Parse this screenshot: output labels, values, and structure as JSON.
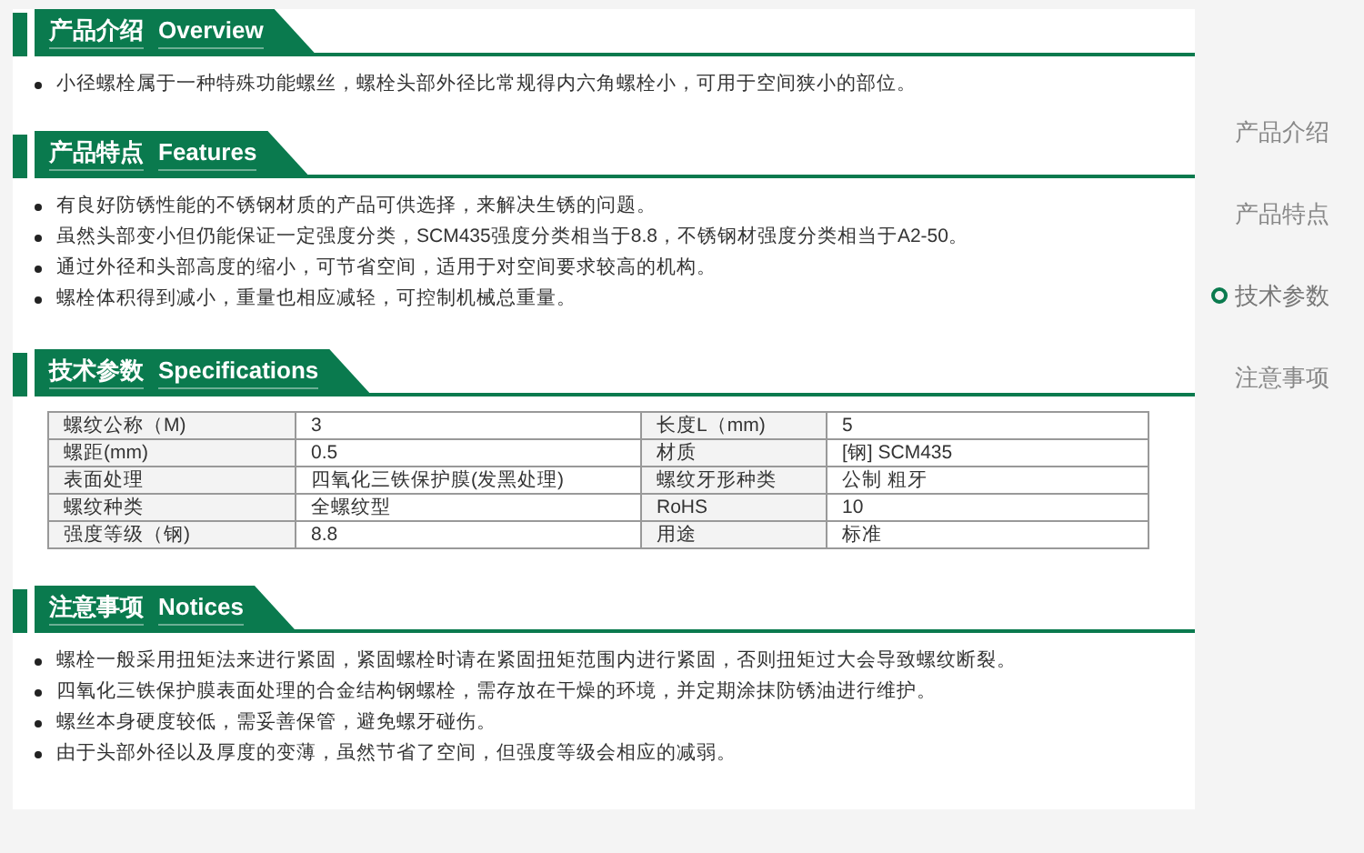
{
  "sections": [
    {
      "kind": "list",
      "title_cn": "产品介绍",
      "title_en": "Overview",
      "items": [
        "小径螺栓属于一种特殊功能螺丝，螺栓头部外径比常规得内六角螺栓小，可用于空间狭小的部位。"
      ]
    },
    {
      "kind": "list",
      "title_cn": "产品特点",
      "title_en": "Features",
      "items": [
        "有良好防锈性能的不锈钢材质的产品可供选择，来解决生锈的问题。",
        "虽然头部变小但仍能保证一定强度分类，SCM435强度分类相当于8.8，不锈钢材强度分类相当于A2-50。",
        "通过外径和头部高度的缩小，可节省空间，适用于对空间要求较高的机构。",
        "螺栓体积得到减小，重量也相应减轻，可控制机械总重量。"
      ]
    },
    {
      "kind": "table",
      "title_cn": "技术参数",
      "title_en": "Specifications",
      "rows": [
        [
          "螺纹公称（M)",
          "3",
          "长度L（mm)",
          "5"
        ],
        [
          "螺距(mm)",
          "0.5",
          "材质",
          "[钢] SCM435"
        ],
        [
          "表面处理",
          "四氧化三铁保护膜(发黑处理)",
          "螺纹牙形种类",
          "公制 粗牙"
        ],
        [
          "螺纹种类",
          "全螺纹型",
          "RoHS",
          "10"
        ],
        [
          "强度等级（钢)",
          "8.8",
          "用途",
          "标准"
        ]
      ]
    },
    {
      "kind": "list",
      "title_cn": "注意事项",
      "title_en": "Notices",
      "items": [
        "螺栓一般采用扭矩法来进行紧固，紧固螺栓时请在紧固扭矩范围内进行紧固，否则扭矩过大会导致螺纹断裂。",
        "四氧化三铁保护膜表面处理的合金结构钢螺栓，需存放在干燥的环境，并定期涂抹防锈油进行维护。",
        "螺丝本身硬度较低，需妥善保管，避免螺牙碰伤。",
        "由于头部外径以及厚度的变薄，虽然节省了空间，但强度等级会相应的减弱。"
      ]
    }
  ],
  "nav": [
    {
      "label": "产品介绍",
      "selected": false
    },
    {
      "label": "产品特点",
      "selected": false
    },
    {
      "label": "技术参数",
      "selected": true
    },
    {
      "label": "注意事项",
      "selected": false
    }
  ]
}
